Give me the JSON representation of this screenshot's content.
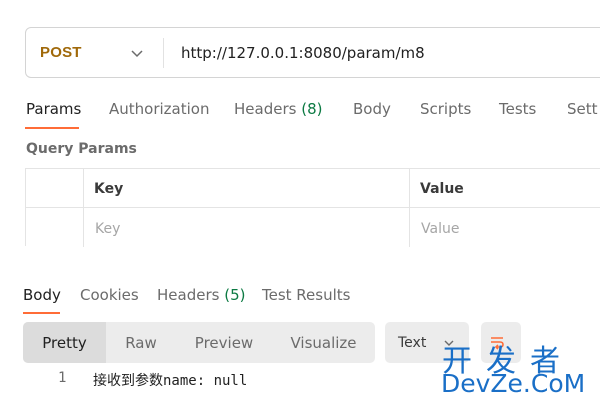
{
  "request": {
    "method": "POST",
    "url": "http://127.0.0.1:8080/param/m8"
  },
  "request_tabs": [
    {
      "label": "Params",
      "active": true
    },
    {
      "label": "Authorization"
    },
    {
      "label": "Headers",
      "count": "(8)"
    },
    {
      "label": "Body"
    },
    {
      "label": "Scripts"
    },
    {
      "label": "Tests"
    },
    {
      "label": "Sett"
    }
  ],
  "query_params": {
    "title": "Query Params",
    "columns": [
      "Key",
      "Value"
    ],
    "placeholder_row": [
      "Key",
      "Value"
    ]
  },
  "response_tabs": [
    {
      "label": "Body",
      "active": true
    },
    {
      "label": "Cookies"
    },
    {
      "label": "Headers",
      "count": "(5)"
    },
    {
      "label": "Test Results"
    }
  ],
  "format_modes": [
    "Pretty",
    "Raw",
    "Preview",
    "Visualize"
  ],
  "active_format": "Pretty",
  "language_select": {
    "value": "Text"
  },
  "response_body": [
    {
      "line": "1",
      "text": "接收到参数name: null"
    }
  ],
  "icons": {
    "method_dropdown": "chevron-down-icon",
    "language_dropdown": "chevron-down-icon",
    "wrap": "wrap-lines-icon"
  },
  "colors": {
    "accent": "#ff6c37",
    "method": "#a0690a",
    "count": "#0c7a43",
    "watermark": "#1a6fc7"
  },
  "watermark": {
    "top": "开发者",
    "bottom": "DevZe.CoM"
  }
}
